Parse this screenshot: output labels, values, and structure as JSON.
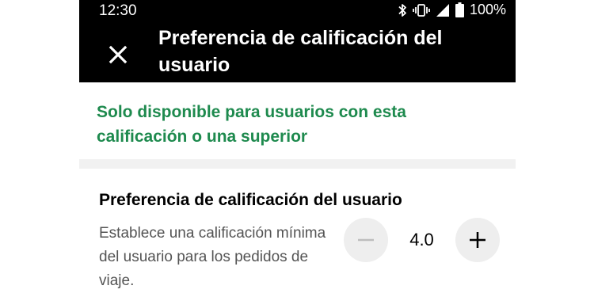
{
  "status_bar": {
    "time": "12:30",
    "battery": "100%",
    "icons": [
      "bluetooth-icon",
      "vibrate-icon",
      "signal-icon",
      "battery-icon"
    ]
  },
  "header": {
    "title": "Preferencia de calificación del usuario",
    "close_icon": "close-icon"
  },
  "banner": {
    "text": "Solo disponible para usuarios con esta calificación o una superior",
    "color": "#1e8a4e"
  },
  "setting": {
    "title": "Preferencia de calificación del usuario",
    "description": "Establece una calificación mínima del usuario para los pedidos de viaje.",
    "stepper": {
      "value": "4.0",
      "decrement_icon": "minus-icon",
      "increment_icon": "plus-icon"
    }
  },
  "colors": {
    "header_bg": "#000000",
    "accent_green": "#1e8a4e",
    "page_bg": "#f1f1f1",
    "stepper_bg": "#eeeeee"
  }
}
